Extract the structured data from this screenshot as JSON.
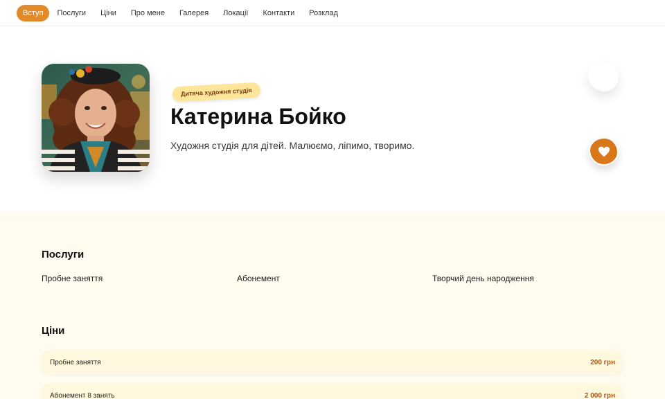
{
  "nav": {
    "items": [
      {
        "label": "Вступ",
        "active": true
      },
      {
        "label": "Послуги"
      },
      {
        "label": "Ціни"
      },
      {
        "label": "Про мене"
      },
      {
        "label": "Галерея"
      },
      {
        "label": "Локації"
      },
      {
        "label": "Контакти"
      },
      {
        "label": "Розклад"
      }
    ]
  },
  "hero": {
    "tag": "Дитяча художня студія",
    "title": "Катерина Бойко",
    "subtitle": "Художня студія для дітей. Малюємо, ліпимо, творимо.",
    "avatar_icon": "portrait-photo",
    "favorite_icon": "heart-icon"
  },
  "services": {
    "title": "Послуги",
    "items": [
      "Пробне заняття",
      "Абонемент",
      "Творчий день народження"
    ]
  },
  "prices": {
    "title": "Ціни",
    "items": [
      {
        "name": "Пробне заняття",
        "price": "200 грн"
      },
      {
        "name": "Абонемент 8 занять",
        "price": "2 000 грн"
      }
    ]
  },
  "colors": {
    "accent": "#e2892a",
    "tag_bg": "#fde59a",
    "heart_bg": "#d9781a",
    "price_text": "#b0560f",
    "section_bg": "#fffbee"
  }
}
